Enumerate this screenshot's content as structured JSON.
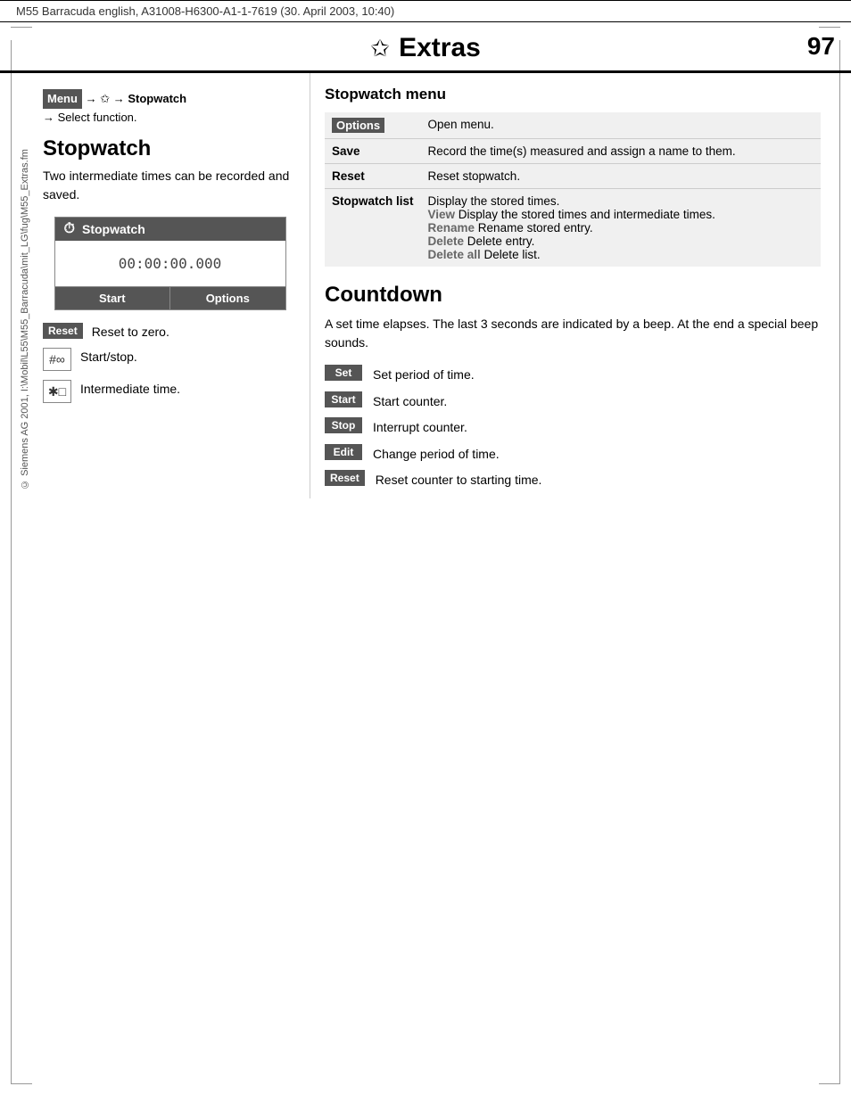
{
  "header": {
    "text": "M55 Barracuda english, A31008-H6300-A1-1-7619 (30. April 2003, 10:40)"
  },
  "page_title": {
    "star": "✩",
    "title": "Extras",
    "page_number": "97"
  },
  "breadcrumb": {
    "menu_label": "Menu",
    "arrow1": "→",
    "star": "✩",
    "arrow2": "→",
    "bold_item": "Stopwatch",
    "arrow3": "→",
    "select_text": "Select function."
  },
  "stopwatch": {
    "section_title": "Stopwatch",
    "description": "Two intermediate times can be recorded and saved.",
    "box_title": "Stopwatch",
    "time_display": "00:00:00.000",
    "btn_start": "Start",
    "btn_options": "Options"
  },
  "key_items": [
    {
      "badge": "Reset",
      "is_badge": true,
      "icon": "",
      "label": "Reset to zero."
    },
    {
      "is_badge": false,
      "icon": "#∞",
      "label": "Start/stop."
    },
    {
      "is_badge": false,
      "icon": "✱□",
      "label": "Intermediate time."
    }
  ],
  "stopwatch_menu": {
    "title": "Stopwatch menu",
    "rows": [
      {
        "key": "Options",
        "is_options": true,
        "value": "Open menu."
      },
      {
        "key": "Save",
        "is_options": false,
        "value": "Record the time(s) measured and assign a name to them."
      },
      {
        "key": "Reset",
        "is_options": false,
        "value": "Reset stopwatch."
      },
      {
        "key": "Stopwatch list",
        "is_options": false,
        "value": "Display the stored times.\nView Display the stored times and intermediate times.\nRename Rename stored entry.\nDelete Delete entry.\nDelete all Delete list."
      }
    ]
  },
  "countdown": {
    "title": "Countdown",
    "description": "A set time elapses. The last 3 seconds are indicated by a beep. At the end a special beep sounds.",
    "items": [
      {
        "badge": "Set",
        "label": "Set period of time."
      },
      {
        "badge": "Start",
        "label": "Start counter."
      },
      {
        "badge": "Stop",
        "label": "Interrupt counter."
      },
      {
        "badge": "Edit",
        "label": "Change period of time."
      },
      {
        "badge": "Reset",
        "label": "Reset counter to starting time."
      }
    ]
  },
  "sidebar": {
    "copyright": "© Siemens AG 2001, I:\\Mobil\\L55\\M55_Barracuda\\mit_LG\\fug\\M55_Extras.fm"
  }
}
